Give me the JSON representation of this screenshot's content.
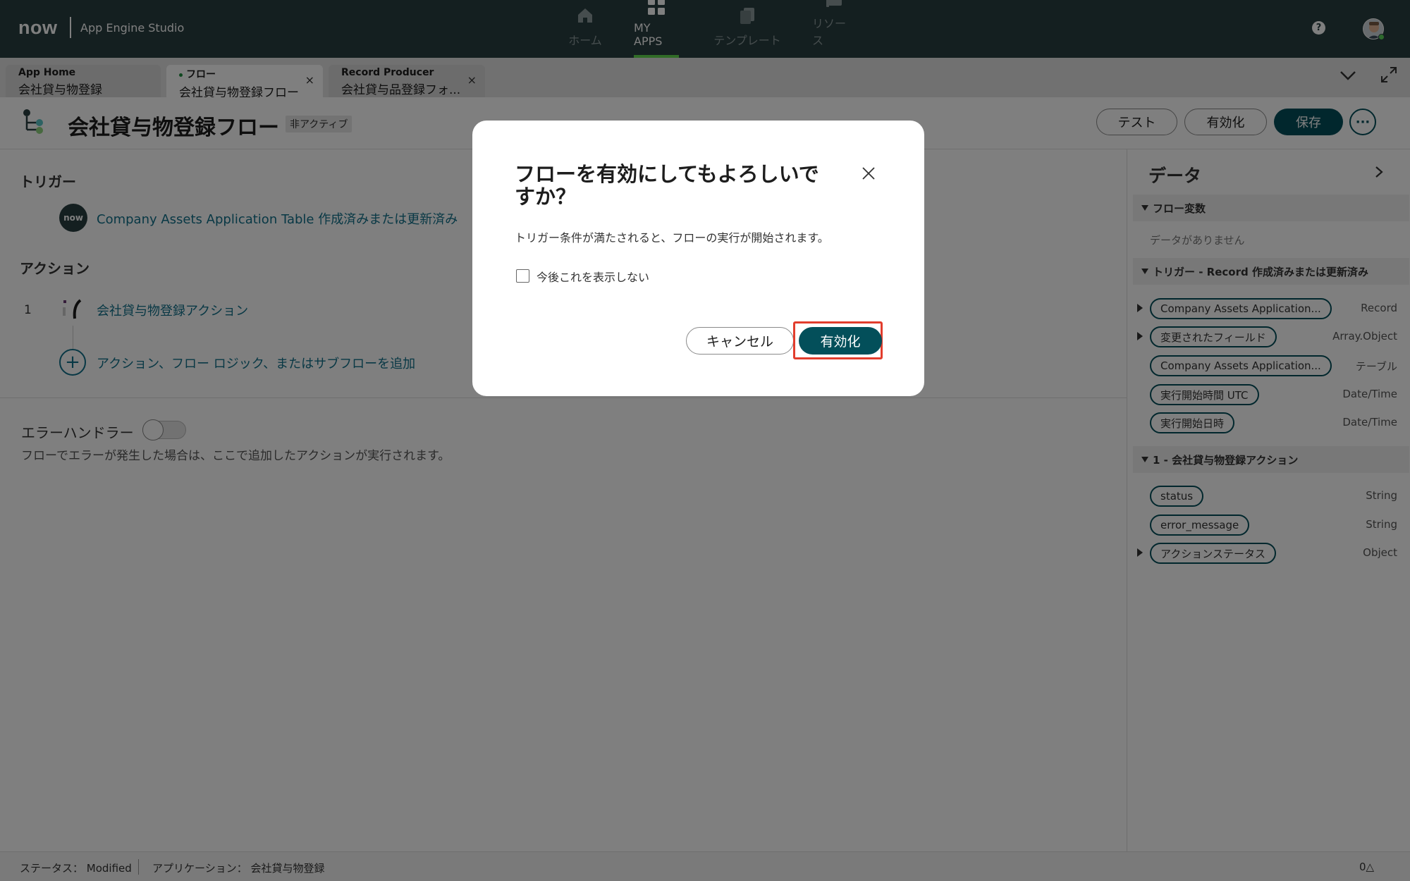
{
  "topbar": {
    "logo": "now",
    "app_name": "App Engine Studio",
    "nav": [
      {
        "label": "ホーム",
        "icon": "home-icon"
      },
      {
        "label": "MY APPS",
        "icon": "grid-icon"
      },
      {
        "label": "テンプレート",
        "icon": "template-icon"
      },
      {
        "label": "リソース",
        "icon": "resources-icon"
      }
    ],
    "help_label": "?"
  },
  "tabs": [
    {
      "title": "App Home",
      "subtitle": "会社貸与物登録"
    },
    {
      "title": "フロー",
      "subtitle": "会社貸与物登録フロー",
      "close": "×"
    },
    {
      "title": "Record Producer",
      "subtitle": "会社貸与品登録フォ...",
      "close": "×"
    }
  ],
  "header": {
    "title": "会社貸与物登録フロー",
    "badge": "非アクティブ",
    "test_label": "テスト",
    "activate_label": "有効化",
    "save_label": "保存",
    "more_label": "···"
  },
  "main": {
    "trigger_heading": "トリガー",
    "now_badge": "now",
    "trigger_text": "Company Assets Application Table 作成済みまたは更新済み",
    "action_heading": "アクション",
    "action_number": "1",
    "action_text": "会社貸与物登録アクション",
    "add_label": "アクション、フロー ロジック、またはサブフローを追加",
    "error_handler_label": "エラーハンドラー",
    "error_handler_desc": "フローでエラーが発生した場合は、ここで追加したアクションが実行されます。"
  },
  "data_panel": {
    "title": "データ",
    "groups": [
      {
        "label": "フロー変数",
        "empty": "データがありません"
      },
      {
        "label": "トリガー - Record 作成済みまたは更新済み"
      },
      {
        "label": "1 - 会社貸与物登録アクション"
      }
    ],
    "trigger_items": [
      {
        "label": "Company Assets Application...",
        "type": "Record"
      },
      {
        "label": "変更されたフィールド",
        "type": "Array.Object"
      },
      {
        "label": "Company Assets Application...",
        "type": "テーブル"
      },
      {
        "label": "実行開始時間 UTC",
        "type": "Date/Time"
      },
      {
        "label": "実行開始日時",
        "type": "Date/Time"
      }
    ],
    "action_items": [
      {
        "label": "status",
        "type": "String"
      },
      {
        "label": "error_message",
        "type": "String"
      },
      {
        "label": "アクションステータス",
        "type": "Object"
      }
    ]
  },
  "status_bar": {
    "status": "ステータス： Modified",
    "application": "アプリケーション： 会社貸与物登録",
    "count": "0"
  },
  "modal": {
    "title": "フローを有効にしてもよろしいですか？",
    "description": "トリガー条件が満たされると、フローの実行が開始されます。",
    "checkbox_label": "今後これを表示しない",
    "cancel_label": "キャンセル",
    "confirm_label": "有効化"
  }
}
